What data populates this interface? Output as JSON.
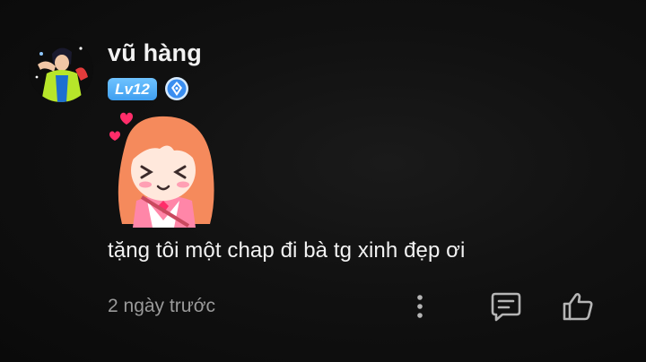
{
  "comment": {
    "user": {
      "name": "vũ hàng",
      "level": "Lv12",
      "avatar_icon": "user-avatar-icon",
      "vip_icon": "vip-diamond-badge-icon"
    },
    "sticker": "blushing-girl-sticker-icon",
    "text": "tặng tôi một chap đi bà tg xinh đẹp ơi",
    "time": "2 ngày trước",
    "actions": {
      "more_icon": "more-vertical-icon",
      "reply_icon": "reply-comment-icon",
      "like_icon": "thumbs-up-icon"
    },
    "colors": {
      "background": "#0a0a0a",
      "text": "#f2f2f2",
      "muted": "#9a9a9a",
      "level_badge": "#4aa8f5"
    }
  }
}
